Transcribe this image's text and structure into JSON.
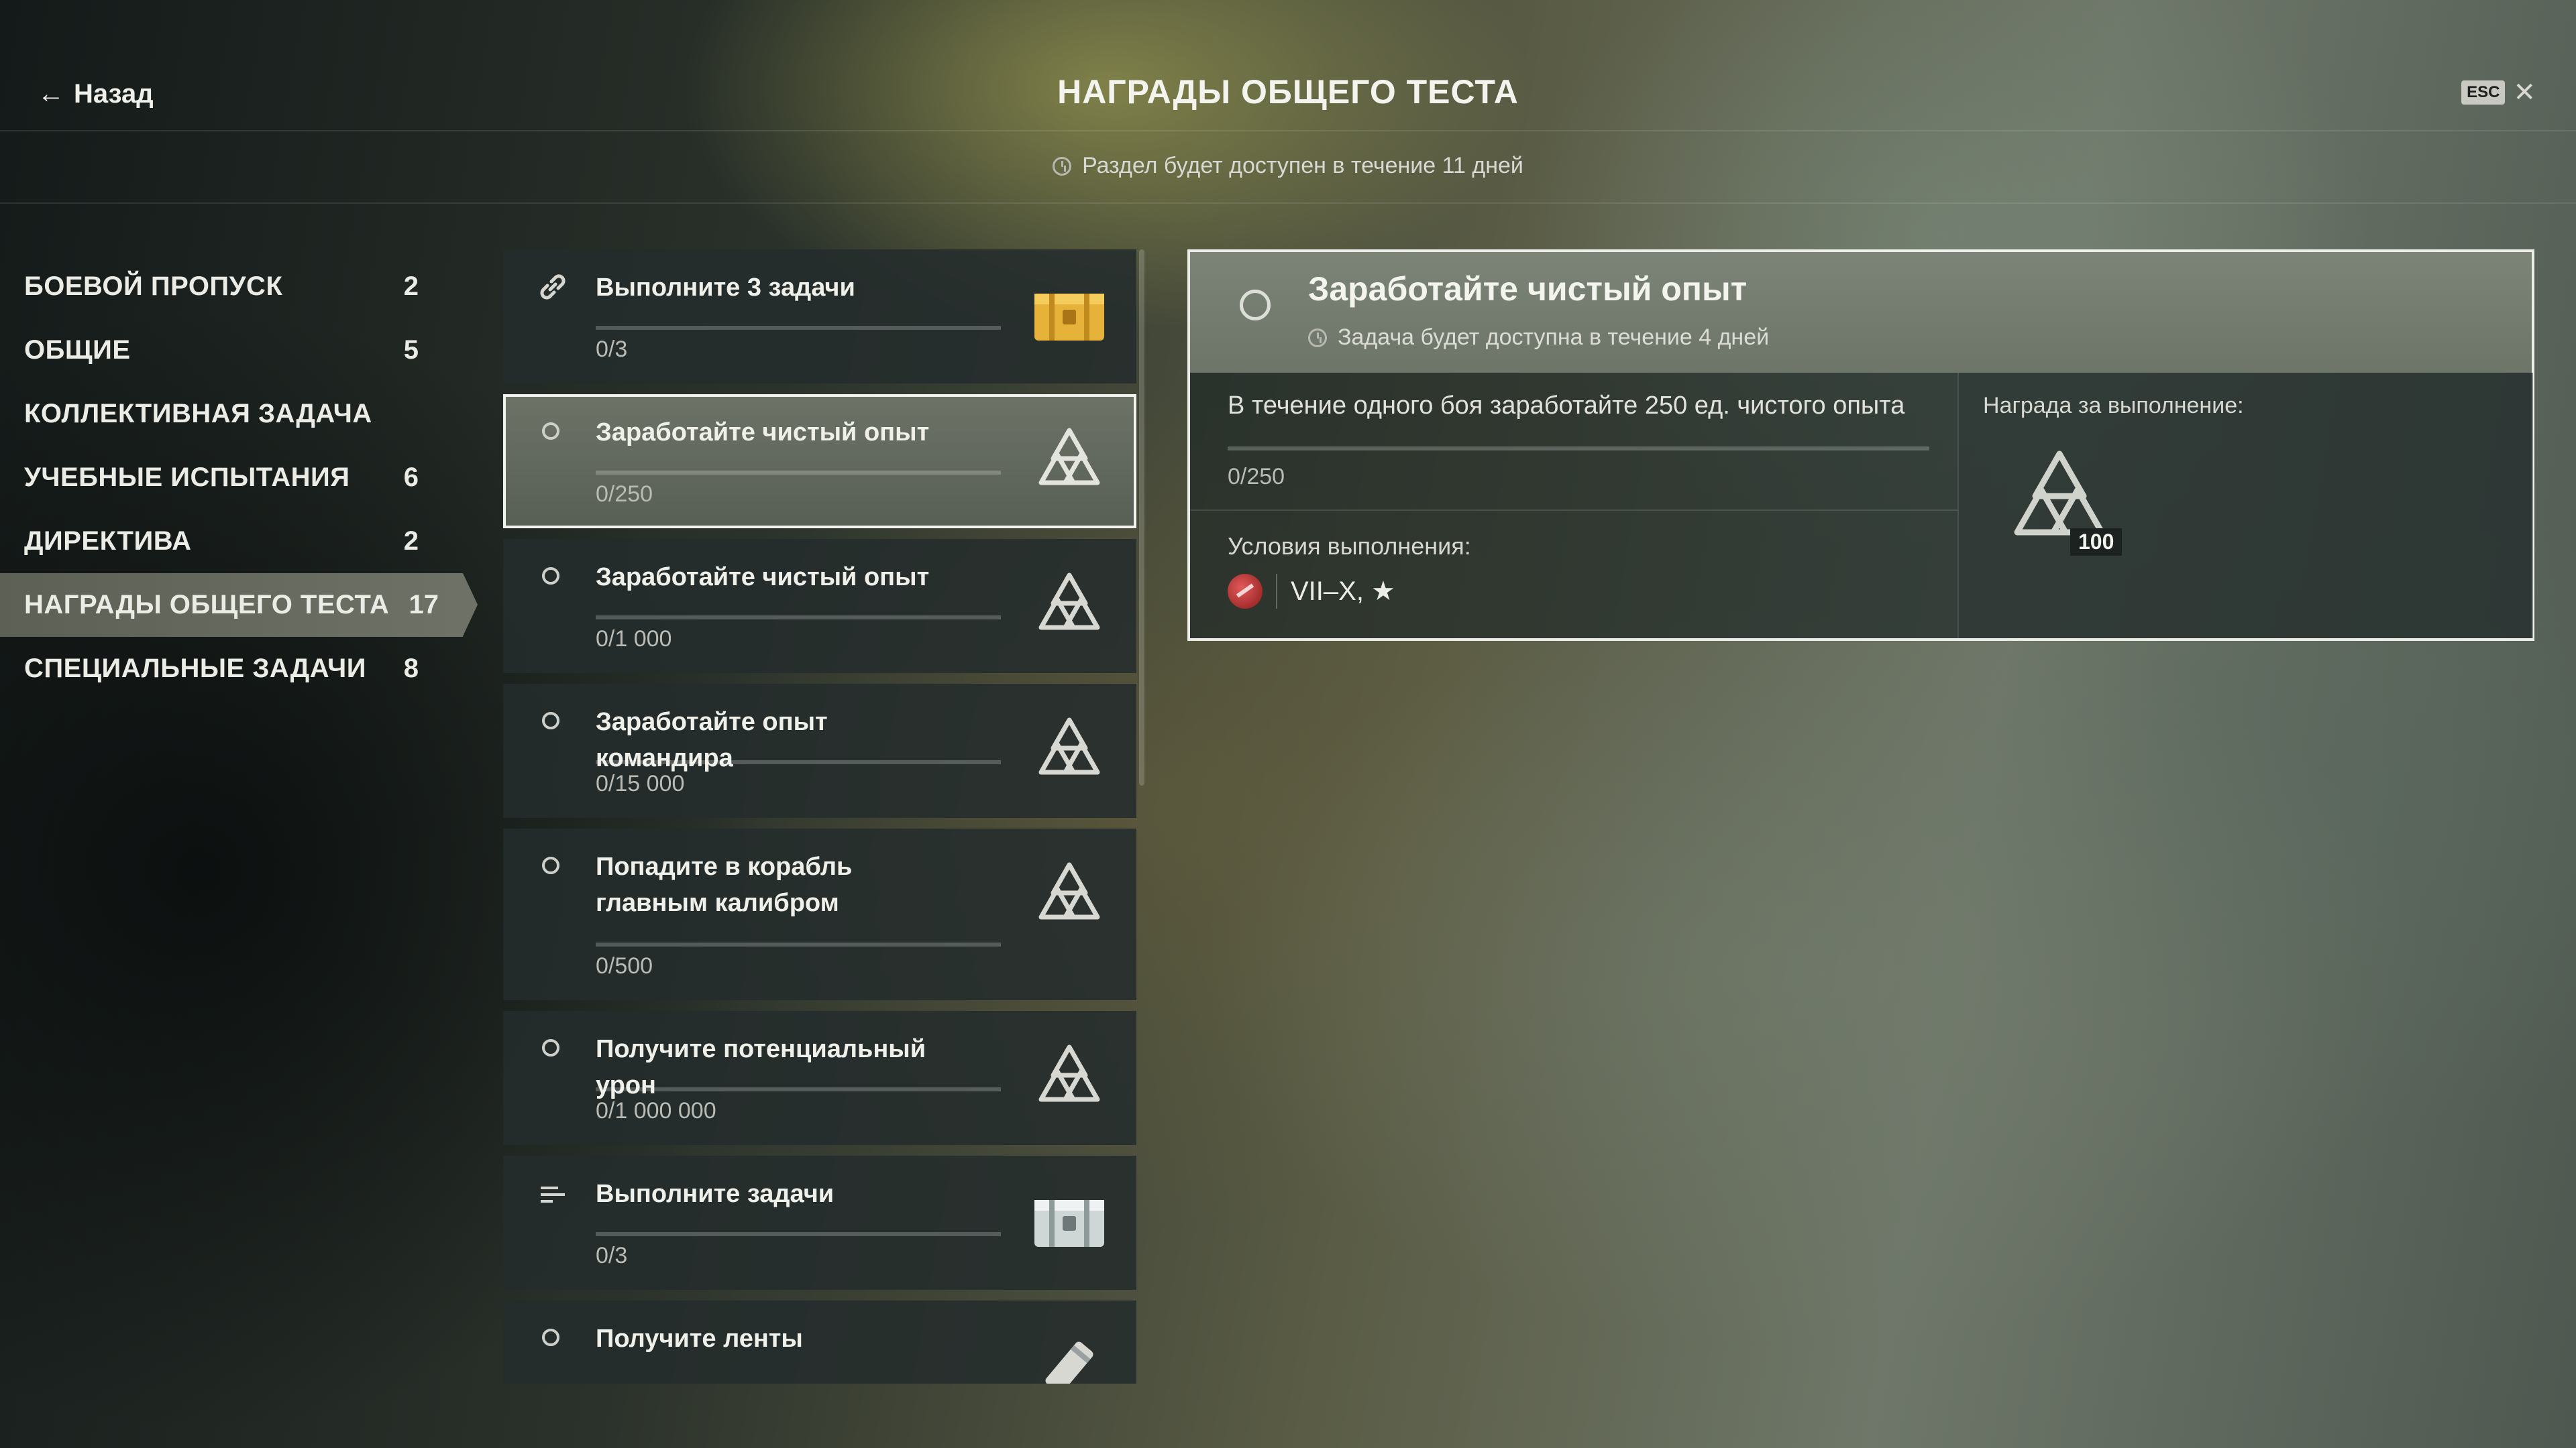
{
  "header": {
    "back_label": "Назад",
    "title": "НАГРАДЫ ОБЩЕГО ТЕСТА",
    "esc_label": "ESC",
    "close_glyph": "✕",
    "timer_text": "Раздел будет доступен в течение 11 дней"
  },
  "sidebar": {
    "items": [
      {
        "label": "БОЕВОЙ ПРОПУСК",
        "count": "2"
      },
      {
        "label": "ОБЩИЕ",
        "count": "5"
      },
      {
        "label": "КОЛЛЕКТИВНАЯ ЗАДАЧА",
        "count": ""
      },
      {
        "label": "УЧЕБНЫЕ ИСПЫТАНИЯ",
        "count": "6"
      },
      {
        "label": "ДИРЕКТИВА",
        "count": "2"
      },
      {
        "label": "НАГРАДЫ ОБЩЕГО ТЕСТА",
        "count": "17",
        "active": true
      },
      {
        "label": "СПЕЦИАЛЬНЫЕ ЗАДАЧИ",
        "count": "8"
      }
    ]
  },
  "tasks": [
    {
      "title": "Выполните 3 задачи",
      "progress": "0/3",
      "lead_icon": "chain-link-icon",
      "reward_icon": "gold-container-icon"
    },
    {
      "title": "Заработайте чистый опыт",
      "progress": "0/250",
      "lead_icon": "status-circle-icon",
      "reward_icon": "free-xp-token-icon",
      "selected": true
    },
    {
      "title": "Заработайте чистый опыт",
      "progress": "0/1 000",
      "lead_icon": "status-circle-icon",
      "reward_icon": "free-xp-token-icon"
    },
    {
      "title": "Заработайте опыт командира",
      "progress": "0/15 000",
      "lead_icon": "status-circle-icon",
      "reward_icon": "free-xp-token-icon"
    },
    {
      "title": "Попадите в корабль главным калибром",
      "progress": "0/500",
      "lead_icon": "status-circle-icon",
      "reward_icon": "free-xp-token-icon"
    },
    {
      "title": "Получите потенциальный урон",
      "progress": "0/1 000 000",
      "lead_icon": "status-circle-icon",
      "reward_icon": "free-xp-token-icon"
    },
    {
      "title": "Выполните задачи",
      "progress": "0/3",
      "lead_icon": "sequence-list-icon",
      "reward_icon": "silver-container-icon"
    },
    {
      "title": "Получите ленты",
      "progress": "",
      "lead_icon": "status-circle-icon",
      "reward_icon": "ribbon-icon"
    }
  ],
  "details": {
    "title": "Заработайте чистый опыт",
    "subtitle": "Задача будет доступна в течение 4 дней",
    "description": "В течение одного боя заработайте 250 ед. чистого опыта",
    "progress": "0/250",
    "conditions_label": "Условия выполнения:",
    "conditions_value": "VII–X, ★",
    "reward_label": "Награда за выполнение:",
    "reward_count": "100",
    "reward_icon": "free-xp-token-icon",
    "condition_icon": "nation-flag-icon"
  },
  "colors": {
    "selected_border": "#f2f2ee",
    "active_tab": "#6e7266",
    "gold": "#e6b23a"
  }
}
